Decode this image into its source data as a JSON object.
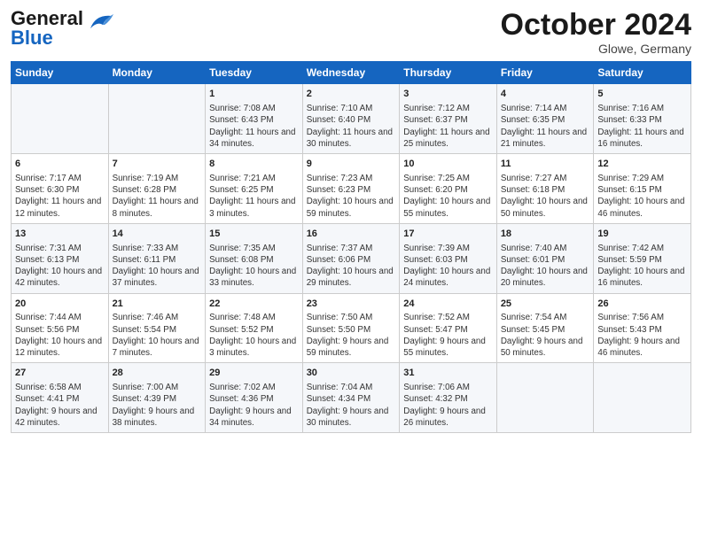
{
  "header": {
    "logo_line1": "General",
    "logo_line2": "Blue",
    "month": "October 2024",
    "location": "Glowe, Germany"
  },
  "weekdays": [
    "Sunday",
    "Monday",
    "Tuesday",
    "Wednesday",
    "Thursday",
    "Friday",
    "Saturday"
  ],
  "weeks": [
    [
      {
        "day": "",
        "content": ""
      },
      {
        "day": "",
        "content": ""
      },
      {
        "day": "1",
        "content": "Sunrise: 7:08 AM\nSunset: 6:43 PM\nDaylight: 11 hours and 34 minutes."
      },
      {
        "day": "2",
        "content": "Sunrise: 7:10 AM\nSunset: 6:40 PM\nDaylight: 11 hours and 30 minutes."
      },
      {
        "day": "3",
        "content": "Sunrise: 7:12 AM\nSunset: 6:37 PM\nDaylight: 11 hours and 25 minutes."
      },
      {
        "day": "4",
        "content": "Sunrise: 7:14 AM\nSunset: 6:35 PM\nDaylight: 11 hours and 21 minutes."
      },
      {
        "day": "5",
        "content": "Sunrise: 7:16 AM\nSunset: 6:33 PM\nDaylight: 11 hours and 16 minutes."
      }
    ],
    [
      {
        "day": "6",
        "content": "Sunrise: 7:17 AM\nSunset: 6:30 PM\nDaylight: 11 hours and 12 minutes."
      },
      {
        "day": "7",
        "content": "Sunrise: 7:19 AM\nSunset: 6:28 PM\nDaylight: 11 hours and 8 minutes."
      },
      {
        "day": "8",
        "content": "Sunrise: 7:21 AM\nSunset: 6:25 PM\nDaylight: 11 hours and 3 minutes."
      },
      {
        "day": "9",
        "content": "Sunrise: 7:23 AM\nSunset: 6:23 PM\nDaylight: 10 hours and 59 minutes."
      },
      {
        "day": "10",
        "content": "Sunrise: 7:25 AM\nSunset: 6:20 PM\nDaylight: 10 hours and 55 minutes."
      },
      {
        "day": "11",
        "content": "Sunrise: 7:27 AM\nSunset: 6:18 PM\nDaylight: 10 hours and 50 minutes."
      },
      {
        "day": "12",
        "content": "Sunrise: 7:29 AM\nSunset: 6:15 PM\nDaylight: 10 hours and 46 minutes."
      }
    ],
    [
      {
        "day": "13",
        "content": "Sunrise: 7:31 AM\nSunset: 6:13 PM\nDaylight: 10 hours and 42 minutes."
      },
      {
        "day": "14",
        "content": "Sunrise: 7:33 AM\nSunset: 6:11 PM\nDaylight: 10 hours and 37 minutes."
      },
      {
        "day": "15",
        "content": "Sunrise: 7:35 AM\nSunset: 6:08 PM\nDaylight: 10 hours and 33 minutes."
      },
      {
        "day": "16",
        "content": "Sunrise: 7:37 AM\nSunset: 6:06 PM\nDaylight: 10 hours and 29 minutes."
      },
      {
        "day": "17",
        "content": "Sunrise: 7:39 AM\nSunset: 6:03 PM\nDaylight: 10 hours and 24 minutes."
      },
      {
        "day": "18",
        "content": "Sunrise: 7:40 AM\nSunset: 6:01 PM\nDaylight: 10 hours and 20 minutes."
      },
      {
        "day": "19",
        "content": "Sunrise: 7:42 AM\nSunset: 5:59 PM\nDaylight: 10 hours and 16 minutes."
      }
    ],
    [
      {
        "day": "20",
        "content": "Sunrise: 7:44 AM\nSunset: 5:56 PM\nDaylight: 10 hours and 12 minutes."
      },
      {
        "day": "21",
        "content": "Sunrise: 7:46 AM\nSunset: 5:54 PM\nDaylight: 10 hours and 7 minutes."
      },
      {
        "day": "22",
        "content": "Sunrise: 7:48 AM\nSunset: 5:52 PM\nDaylight: 10 hours and 3 minutes."
      },
      {
        "day": "23",
        "content": "Sunrise: 7:50 AM\nSunset: 5:50 PM\nDaylight: 9 hours and 59 minutes."
      },
      {
        "day": "24",
        "content": "Sunrise: 7:52 AM\nSunset: 5:47 PM\nDaylight: 9 hours and 55 minutes."
      },
      {
        "day": "25",
        "content": "Sunrise: 7:54 AM\nSunset: 5:45 PM\nDaylight: 9 hours and 50 minutes."
      },
      {
        "day": "26",
        "content": "Sunrise: 7:56 AM\nSunset: 5:43 PM\nDaylight: 9 hours and 46 minutes."
      }
    ],
    [
      {
        "day": "27",
        "content": "Sunrise: 6:58 AM\nSunset: 4:41 PM\nDaylight: 9 hours and 42 minutes."
      },
      {
        "day": "28",
        "content": "Sunrise: 7:00 AM\nSunset: 4:39 PM\nDaylight: 9 hours and 38 minutes."
      },
      {
        "day": "29",
        "content": "Sunrise: 7:02 AM\nSunset: 4:36 PM\nDaylight: 9 hours and 34 minutes."
      },
      {
        "day": "30",
        "content": "Sunrise: 7:04 AM\nSunset: 4:34 PM\nDaylight: 9 hours and 30 minutes."
      },
      {
        "day": "31",
        "content": "Sunrise: 7:06 AM\nSunset: 4:32 PM\nDaylight: 9 hours and 26 minutes."
      },
      {
        "day": "",
        "content": ""
      },
      {
        "day": "",
        "content": ""
      }
    ]
  ]
}
